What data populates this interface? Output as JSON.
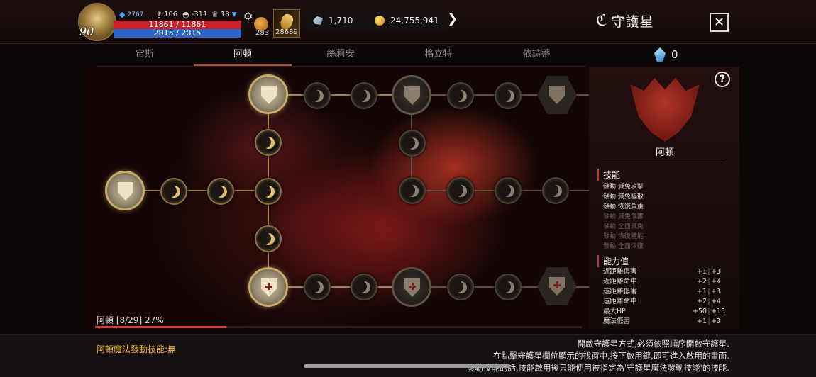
{
  "player": {
    "level": "90",
    "gems": "2767",
    "keys": "106",
    "helm": "-311",
    "trophy": "18",
    "hp": "11861 / 11861",
    "mp": "2015 / 2015",
    "potion_count": "283",
    "item_count": "28689"
  },
  "currency": {
    "crystal": "1,710",
    "gold": "24,755,941"
  },
  "header": {
    "title": "守護星",
    "close_label": "✕"
  },
  "tabs": [
    {
      "label": "宙斯"
    },
    {
      "label": "阿頓"
    },
    {
      "label": "絲莉安"
    },
    {
      "label": "格立特"
    },
    {
      "label": "依詩蒂"
    }
  ],
  "star_points": "0",
  "progress": {
    "label": "阿頓 [8/29] 27%",
    "fraction": 0.27
  },
  "panel": {
    "name": "阿頓",
    "skills_title": "技能",
    "skills": [
      {
        "text": "發動 減免攻擊",
        "active": true
      },
      {
        "text": "發動 減免驅散",
        "active": true
      },
      {
        "text": "發動 恢復負重",
        "active": true
      },
      {
        "text": "發動 減免傷害",
        "active": false
      },
      {
        "text": "發動 全面減免",
        "active": false
      },
      {
        "text": "發動 恢復體能",
        "active": false
      },
      {
        "text": "發動 全面恢復",
        "active": false
      }
    ],
    "stats_title": "能力值",
    "stats": [
      {
        "name": "近距離傷害",
        "v1": "+1",
        "v2": "+3"
      },
      {
        "name": "近距離命中",
        "v1": "+2",
        "v2": "+4"
      },
      {
        "name": "遠距離傷害",
        "v1": "+1",
        "v2": "+3"
      },
      {
        "name": "遠距離命中",
        "v1": "+2",
        "v2": "+4"
      },
      {
        "name": "最大HP",
        "v1": "+50",
        "v2": "+15"
      },
      {
        "name": "魔法傷害",
        "v1": "+1",
        "v2": "+3"
      }
    ],
    "stat_sep": "|",
    "help_label": "?"
  },
  "footer": {
    "left": "阿頓魔法發動技能:無",
    "lines": [
      "開啟守護星方式,必須依照順序開啟守護星.",
      "在點擊守護星欄位顯示的視窗中,按下啟用鍵,即可進入啟用的畫面.",
      "發動技能的話,技能啟用後只能使用被指定為'守護星魔法發動技能'的技能."
    ]
  },
  "colors": {
    "hp": "#c8232b",
    "mp": "#2d64c8",
    "accent": "#c0392b",
    "footer_highlight": "#f0b43a"
  }
}
